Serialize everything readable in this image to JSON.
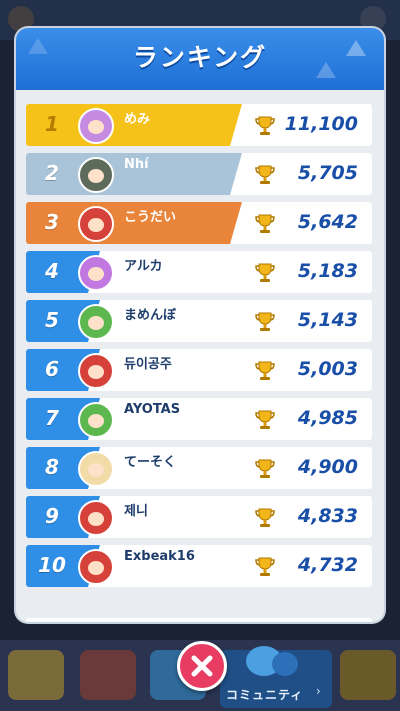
{
  "popup": {
    "title": "ランキング",
    "rows": [
      {
        "rank": "1",
        "name": "めみ",
        "score": "11,100",
        "tier": "gold",
        "avatar_color": "#c58be0"
      },
      {
        "rank": "2",
        "name": "Nhí",
        "score": "5,705",
        "tier": "silver",
        "avatar_color": "#5d6b5a"
      },
      {
        "rank": "3",
        "name": "こうだい",
        "score": "5,642",
        "tier": "bronze",
        "avatar_color": "#d6413a"
      },
      {
        "rank": "4",
        "name": "アルカ",
        "score": "5,183",
        "tier": "normal",
        "avatar_color": "#c178e0"
      },
      {
        "rank": "5",
        "name": "まめんぼ",
        "score": "5,143",
        "tier": "normal",
        "avatar_color": "#5cb84e"
      },
      {
        "rank": "6",
        "name": "듀이공주",
        "score": "5,003",
        "tier": "normal",
        "avatar_color": "#d6413a"
      },
      {
        "rank": "7",
        "name": "AYOTAS",
        "score": "4,985",
        "tier": "normal",
        "avatar_color": "#5cb84e"
      },
      {
        "rank": "8",
        "name": "てーそく",
        "score": "4,900",
        "tier": "normal",
        "avatar_color": "#f1dca8"
      },
      {
        "rank": "9",
        "name": "제니",
        "score": "4,833",
        "tier": "normal",
        "avatar_color": "#d6413a"
      },
      {
        "rank": "10",
        "name": "Exbeak16",
        "score": "4,732",
        "tier": "normal",
        "avatar_color": "#d6413a"
      }
    ]
  },
  "bottom_nav": {
    "community_label": "コミュニティ"
  },
  "icons": {
    "trophy": "trophy-icon",
    "close": "close-icon",
    "chat": "chat-icon"
  },
  "colors": {
    "gold": "#f5c21a",
    "silver": "#a9c4d8",
    "bronze": "#e8853a",
    "rank_blue": "#2f8ee6",
    "score_text": "#1a4fa8",
    "close_button": "#e83c63"
  }
}
